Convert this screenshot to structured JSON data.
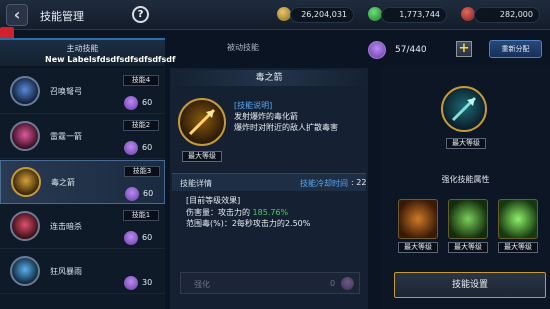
{
  "header": {
    "title": "技能管理",
    "help_label": "?",
    "resources": [
      {
        "name": "gold-coin",
        "value": "26,204,031"
      },
      {
        "name": "green-gem",
        "value": "1,773,744"
      },
      {
        "name": "red-gem",
        "value": "282,000"
      }
    ]
  },
  "tabs": {
    "active": {
      "label": "主动技能",
      "sublabel": "New Labelsfdsdfsdfsdfsdfsdf"
    },
    "passive": {
      "label": "被动技能"
    }
  },
  "skill_points": {
    "value": "57/440",
    "add_label": "+",
    "redistribute_label": "重新分配"
  },
  "skills": [
    {
      "name": "召唤弩弓",
      "level": "技能4",
      "cost": "60",
      "icon": "crossbow-icon"
    },
    {
      "name": "雷霆一箭",
      "level": "技能2",
      "cost": "60",
      "icon": "thunder-arrow-icon"
    },
    {
      "name": "毒之箭",
      "level": "技能3",
      "cost": "60",
      "icon": "poison-arrow-icon"
    },
    {
      "name": "连击暗杀",
      "level": "技能1",
      "cost": "60",
      "icon": "assassinate-icon"
    },
    {
      "name": "狂风暴雨",
      "level": "",
      "cost": "30",
      "icon": "storm-icon"
    }
  ],
  "detail": {
    "skill_title": "毒之箭",
    "max_level_label": "最大等级",
    "desc_head": "[技能说明]",
    "desc_line1": "发射爆炸的毒化箭",
    "desc_line2": "爆炸时对附近的敌人扩散毒害",
    "detail_label": "技能详情",
    "cooldown_label": "技能冷却时间",
    "cooldown_value": ": 22",
    "effect_head": "[目前等级效果]",
    "effect1_label": "伤害量：攻击力的 ",
    "effect1_value": "185.76%",
    "effect2": "范围毒(%)：2每秒攻击力的2.50%",
    "strengthen_label": "强化",
    "strengthen_cost": "0"
  },
  "right_panel": {
    "max_level_label": "最大等级",
    "attr_title": "强化技能属性",
    "attrs": [
      {
        "icon": "compass-target-icon",
        "label": "最大等级"
      },
      {
        "icon": "poison-skull-icon",
        "label": "最大等级"
      },
      {
        "icon": "green-fist-icon",
        "label": "最大等级"
      }
    ],
    "settings_label": "技能设置"
  },
  "colors": {
    "accent_blue": "#58a9f0",
    "value_green": "#4ccb5a",
    "gold_border": "#c79a34"
  }
}
